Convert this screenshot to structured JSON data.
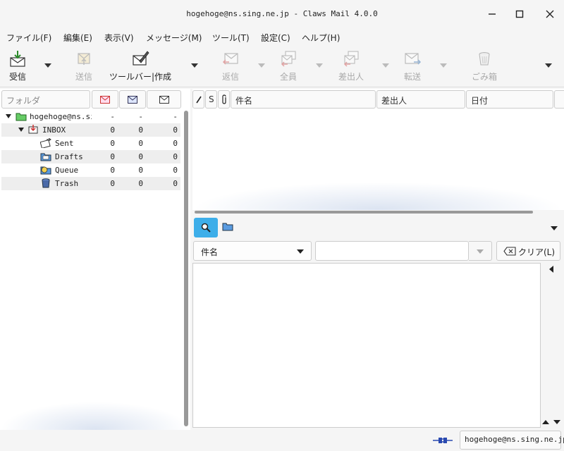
{
  "window": {
    "title": "hogehoge@ns.sing.ne.jp - Claws Mail 4.0.0"
  },
  "menu": [
    "ファイル(F)",
    "編集(E)",
    "表示(V)",
    "メッセージ(M)",
    "ツール(T)",
    "設定(C)",
    "ヘルプ(H)"
  ],
  "toolbar": {
    "receive": "受信",
    "send": "送信",
    "compose": "ツールバー|作成",
    "reply": "返信",
    "reply_all": "全員",
    "reply_sender": "差出人",
    "forward": "転送",
    "trash": "ごみ箱"
  },
  "folder_pane": {
    "header": "フォルダ",
    "account": {
      "name": "hogehoge@ns.sing.ne.jp",
      "new": "-",
      "unread": "-",
      "total": "-"
    },
    "folders": [
      {
        "name": "INBOX",
        "new": "0",
        "unread": "0",
        "total": "0"
      },
      {
        "name": "Sent",
        "new": "0",
        "unread": "0",
        "total": "0"
      },
      {
        "name": "Drafts",
        "new": "0",
        "unread": "0",
        "total": "0"
      },
      {
        "name": "Queue",
        "new": "0",
        "unread": "0",
        "total": "0"
      },
      {
        "name": "Trash",
        "new": "0",
        "unread": "0",
        "total": "0"
      }
    ]
  },
  "message_list": {
    "columns": {
      "status": "S",
      "subject": "件名",
      "from": "差出人",
      "date": "日付"
    }
  },
  "search": {
    "field": "件名",
    "value": "",
    "clear_label": "クリア(L)"
  },
  "statusbar": {
    "account": "hogehoge@ns.sing.ne.jp"
  }
}
